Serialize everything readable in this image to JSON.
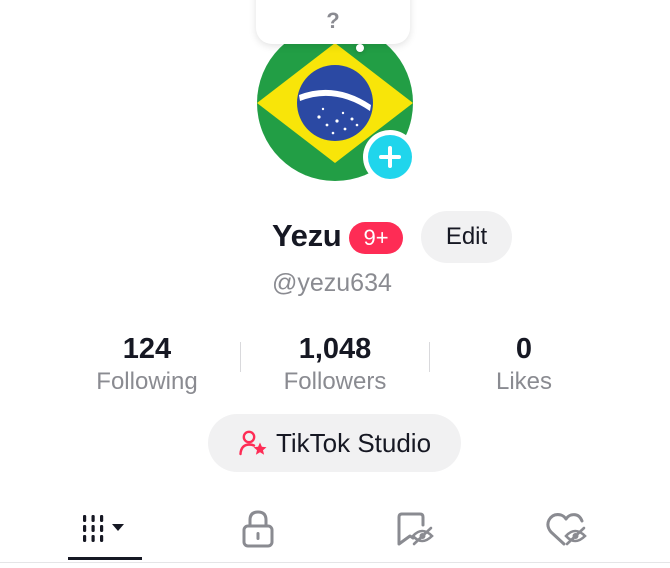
{
  "note": {
    "text": "?"
  },
  "profile": {
    "avatar_icon": "brazil-flag-avatar",
    "add_icon": "plus-icon",
    "username": "Yezu",
    "notification_badge": "9+",
    "edit_label": "Edit",
    "handle": "@yezu634"
  },
  "stats": [
    {
      "value": "124",
      "label": "Following"
    },
    {
      "value": "1,048",
      "label": "Followers"
    },
    {
      "value": "0",
      "label": "Likes"
    }
  ],
  "studio": {
    "label": "TikTok Studio",
    "icon": "person-star-icon"
  },
  "tabs": [
    {
      "name": "videos-grid-tab",
      "icon": "grid-dropdown-icon",
      "selected": true
    },
    {
      "name": "private-tab",
      "icon": "lock-icon",
      "selected": false
    },
    {
      "name": "favorites-tab",
      "icon": "bookmark-hidden-icon",
      "selected": false
    },
    {
      "name": "liked-tab",
      "icon": "heart-hidden-icon",
      "selected": false
    }
  ],
  "colors": {
    "accent_red": "#fe2c55",
    "accent_cyan": "#20d5ec",
    "text_primary": "#161823",
    "text_secondary": "#8a8b91",
    "button_bg": "#f1f1f2"
  }
}
